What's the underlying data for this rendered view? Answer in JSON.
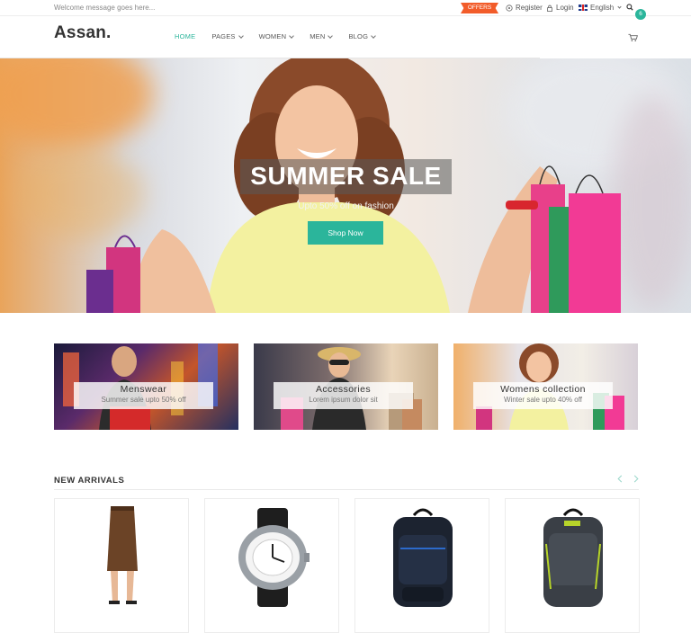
{
  "topbar": {
    "welcome": "Welcome message goes here...",
    "offers": "OFFERS",
    "register": "Register",
    "login": "Login",
    "language": "English"
  },
  "header": {
    "logo": "Assan.",
    "nav": [
      {
        "label": "HOME"
      },
      {
        "label": "PAGES"
      },
      {
        "label": "WOMEN"
      },
      {
        "label": "MEN"
      },
      {
        "label": "BLOG"
      }
    ],
    "cart_count": "6"
  },
  "hero": {
    "title": "SUMMER SALE",
    "subtitle": "Upto 50% off on fashion",
    "button": "Shop Now"
  },
  "categories": [
    {
      "title": "Menswear",
      "subtitle": "Summer sale upto 50% off"
    },
    {
      "title": "Accessories",
      "subtitle": "Lorem ipsum dolor sit"
    },
    {
      "title": "Womens collection",
      "subtitle": "Winter sale upto 40% off"
    }
  ],
  "arrivals": {
    "title": "NEW ARRIVALS"
  },
  "colors": {
    "accent": "#2bb59b",
    "offers": "#f25c2a"
  }
}
